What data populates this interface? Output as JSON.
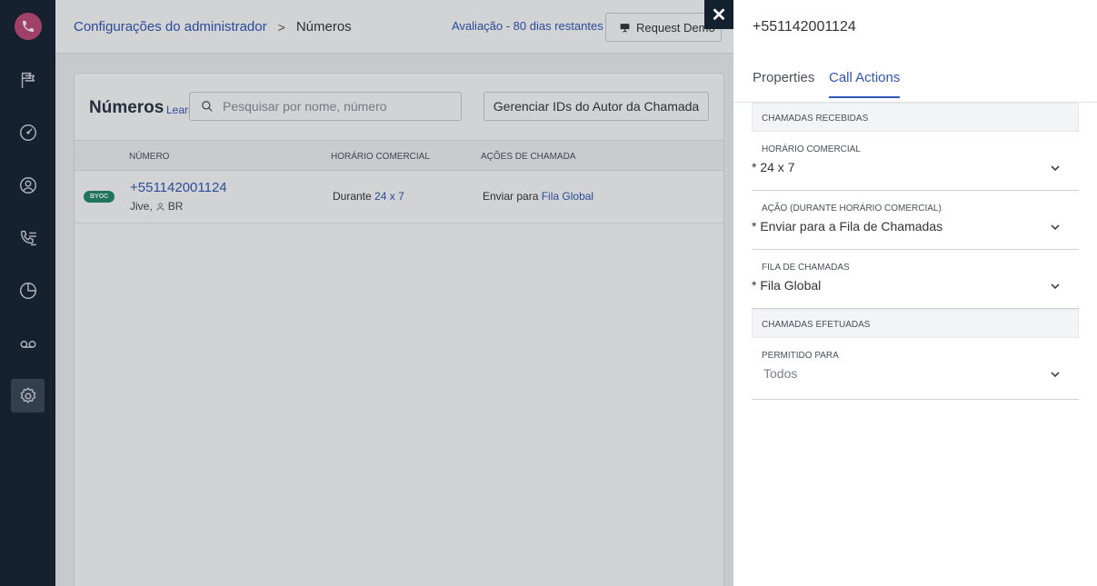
{
  "sidebar": {
    "icons": [
      "phone-icon",
      "flag-icon",
      "gauge-icon",
      "user-icon",
      "call-routing-icon",
      "pie-chart-icon",
      "voicemail-icon",
      "gear-icon"
    ]
  },
  "header": {
    "breadcrumb_parent": "Configurações do administrador",
    "breadcrumb_separator": ">",
    "breadcrumb_current": "Números",
    "trial_text": "Avaliação - 80 dias restantes",
    "demo_label": "Request Demo"
  },
  "numbers_page": {
    "title": "Números",
    "learn_link": "Learn",
    "search_placeholder": "Pesquisar por nome, número",
    "manage_button": "Gerenciar IDs do Autor da Chamada",
    "columns": [
      "NÚMERO",
      "HORÁRIO COMERCIAL",
      "AÇÕES DE CHAMADA"
    ],
    "rows": [
      {
        "badge": "BYOC",
        "number": "+551142001124",
        "sub_text": "Jive,",
        "country": "BR",
        "hours_prefix": "Durante",
        "hours_value": "24 x 7",
        "action_prefix": "Enviar para",
        "action_value": "Fila Global"
      }
    ]
  },
  "panel": {
    "close_label": "✕",
    "title": "+551142001124",
    "tabs": [
      "Properties",
      "Call Actions"
    ],
    "active_tab": "Call Actions",
    "incoming_header": "CHAMADAS RECEBIDAS",
    "outgoing_header": "CHAMADAS EFETUADAS",
    "fields": {
      "business_hours": {
        "label": "HORÁRIO COMERCIAL",
        "value": "* 24 x 7"
      },
      "action": {
        "label": "AÇÃO (DURANTE HORÁRIO COMERCIAL)",
        "value": "* Enviar para a Fila de Chamadas"
      },
      "queue": {
        "label": "FILA DE CHAMADAS",
        "value": "* Fila Global"
      },
      "allowed": {
        "label": "PERMITIDO PARA",
        "value": "Todos"
      }
    }
  },
  "colors": {
    "sidebar_bg": "#13212f",
    "accent_blue": "#2f56b3",
    "byoc_green": "#1f8a64",
    "logo_pink": "#c1497a"
  }
}
